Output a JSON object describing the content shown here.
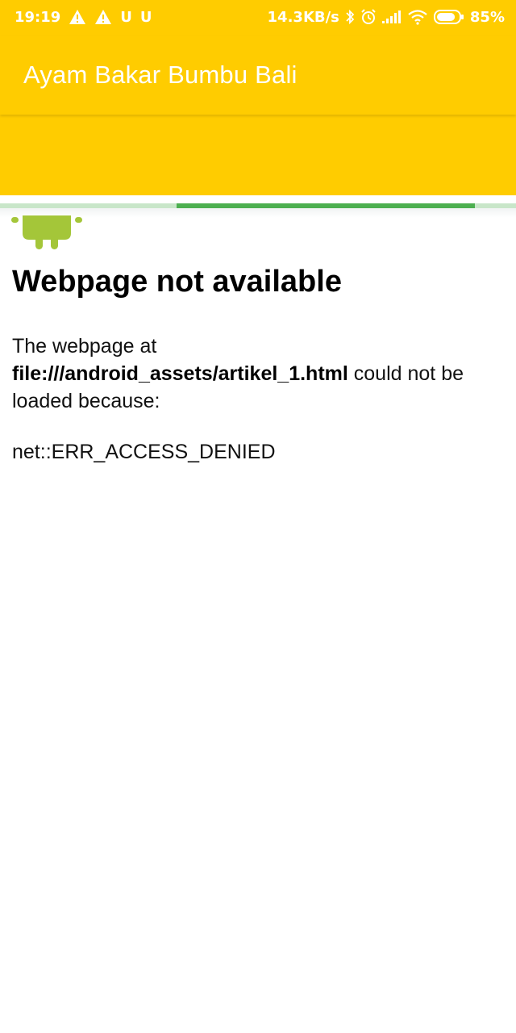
{
  "status_bar": {
    "time": "19:19",
    "network_speed": "14.3KB/s",
    "battery_percent": "85%",
    "battery_level": 0.85,
    "left_icons": [
      "warning-icon",
      "warning-icon",
      "u-icon",
      "u-icon"
    ],
    "u_glyph": "U",
    "right_icons": [
      "bluetooth-icon",
      "alarm-icon",
      "signal-icon",
      "wifi-icon",
      "battery-icon"
    ]
  },
  "app_bar": {
    "title": "Ayam Bakar Bumbu Bali"
  },
  "progress": {
    "value": 0.58
  },
  "webview": {
    "error_title": "Webpage not available",
    "message_prefix": "The webpage at",
    "url": "file:///android_assets/artikel_1.html",
    "message_suffix": "could not be loaded because:",
    "error_code": "net::ERR_ACCESS_DENIED"
  },
  "colors": {
    "app_bar": "#ffcc00",
    "progress_track": "#c8e6c9",
    "progress_fill": "#4caf50",
    "android_green": "#a4c639"
  }
}
